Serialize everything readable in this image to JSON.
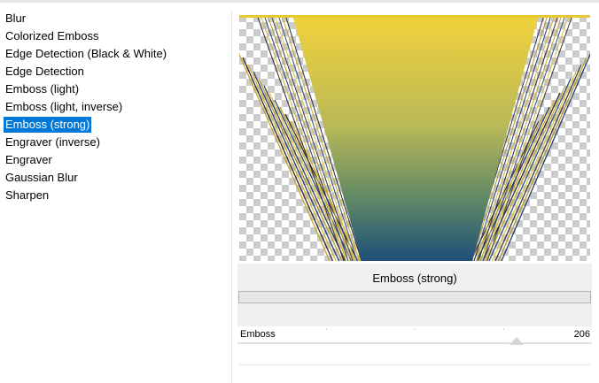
{
  "filters": {
    "items": [
      "Blur",
      "Colorized Emboss",
      "Edge Detection (Black & White)",
      "Edge Detection",
      "Emboss (light)",
      "Emboss (light, inverse)",
      "Emboss (strong)",
      "Engraver (inverse)",
      "Engraver",
      "Gaussian Blur",
      "Sharpen"
    ],
    "selected": "Emboss (strong)"
  },
  "settings": {
    "title": "Emboss (strong)"
  },
  "slider": {
    "label": "Emboss",
    "value": "206",
    "min": 0,
    "max": 255
  },
  "colors": {
    "selection": "#0078d7",
    "preview_top": "#f2d23c",
    "preview_bottom": "#1d4f7a",
    "panel_bg": "#f0f0f0"
  }
}
